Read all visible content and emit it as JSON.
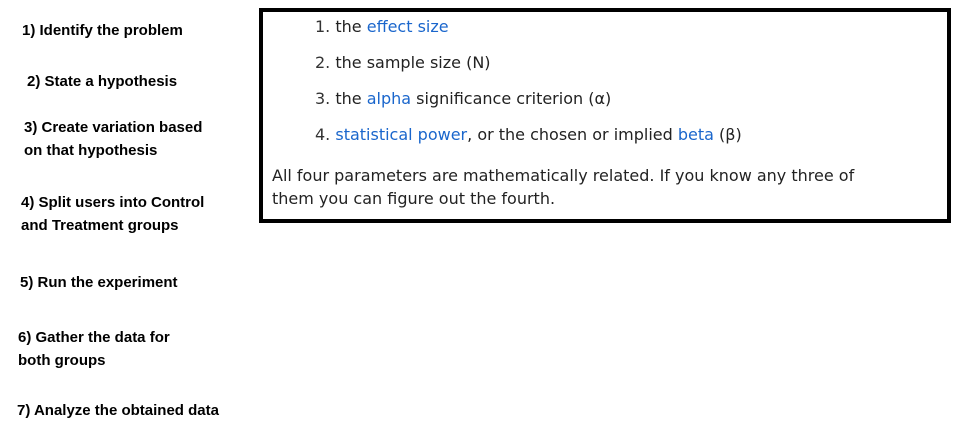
{
  "steps": [
    {
      "label": "1) Identify the problem"
    },
    {
      "line1": "2) State a hypothesis"
    },
    {
      "line1": "3) Create variation based",
      "line2": "on that hypothesis"
    },
    {
      "line1": "4) Split users into Control",
      "line2": "and Treatment groups"
    },
    {
      "label": "5) Run the experiment"
    },
    {
      "line1": "6) Gather the data for",
      "line2": "both groups"
    },
    {
      "label": "7) Analyze the obtained data"
    }
  ],
  "box": {
    "items": [
      {
        "num": "1.",
        "pre": "the",
        "link": "effect size"
      },
      {
        "num": "2.",
        "text": "the sample size (N)"
      },
      {
        "num": "3.",
        "pre": "the",
        "link": "alpha",
        "post": "significance criterion (α)"
      },
      {
        "num": "4.",
        "link1": "statistical power",
        "mid": ", or the chosen or implied",
        "link2": "beta",
        "post": "(β)"
      }
    ],
    "paragraph_line1": "All four parameters are mathematically related. If you know any three of",
    "paragraph_line2": "them you can figure out the fourth."
  },
  "colors": {
    "link": "#1a66cc",
    "border": "#000000"
  }
}
